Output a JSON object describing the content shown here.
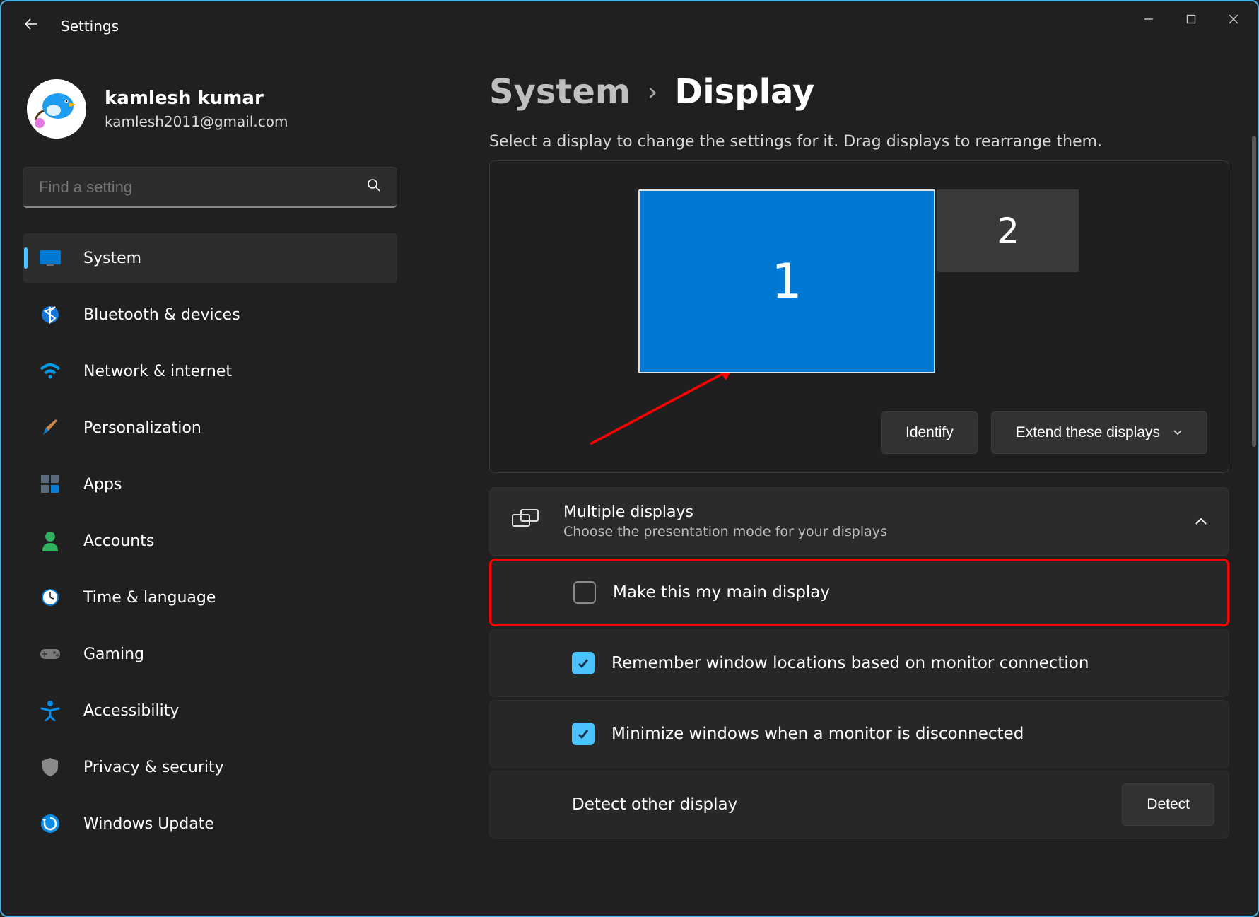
{
  "app": {
    "title": "Settings"
  },
  "user": {
    "name": "kamlesh kumar",
    "email": "kamlesh2011@gmail.com"
  },
  "search": {
    "placeholder": "Find a setting"
  },
  "sidebar": {
    "items": [
      {
        "label": "System"
      },
      {
        "label": "Bluetooth & devices"
      },
      {
        "label": "Network & internet"
      },
      {
        "label": "Personalization"
      },
      {
        "label": "Apps"
      },
      {
        "label": "Accounts"
      },
      {
        "label": "Time & language"
      },
      {
        "label": "Gaming"
      },
      {
        "label": "Accessibility"
      },
      {
        "label": "Privacy & security"
      },
      {
        "label": "Windows Update"
      }
    ]
  },
  "breadcrumb": {
    "parent": "System",
    "current": "Display"
  },
  "hint": "Select a display to change the settings for it. Drag displays to rearrange them.",
  "displays": {
    "d1": "1",
    "d2": "2"
  },
  "arrange": {
    "identify_label": "Identify",
    "mode_label": "Extend these displays"
  },
  "multiple": {
    "title": "Multiple displays",
    "subtitle": "Choose the presentation mode for your displays"
  },
  "options": {
    "make_main": "Make this my main display",
    "remember": "Remember window locations based on monitor connection",
    "minimize": "Minimize windows when a monitor is disconnected",
    "detect_other": "Detect other display",
    "detect_btn": "Detect"
  }
}
